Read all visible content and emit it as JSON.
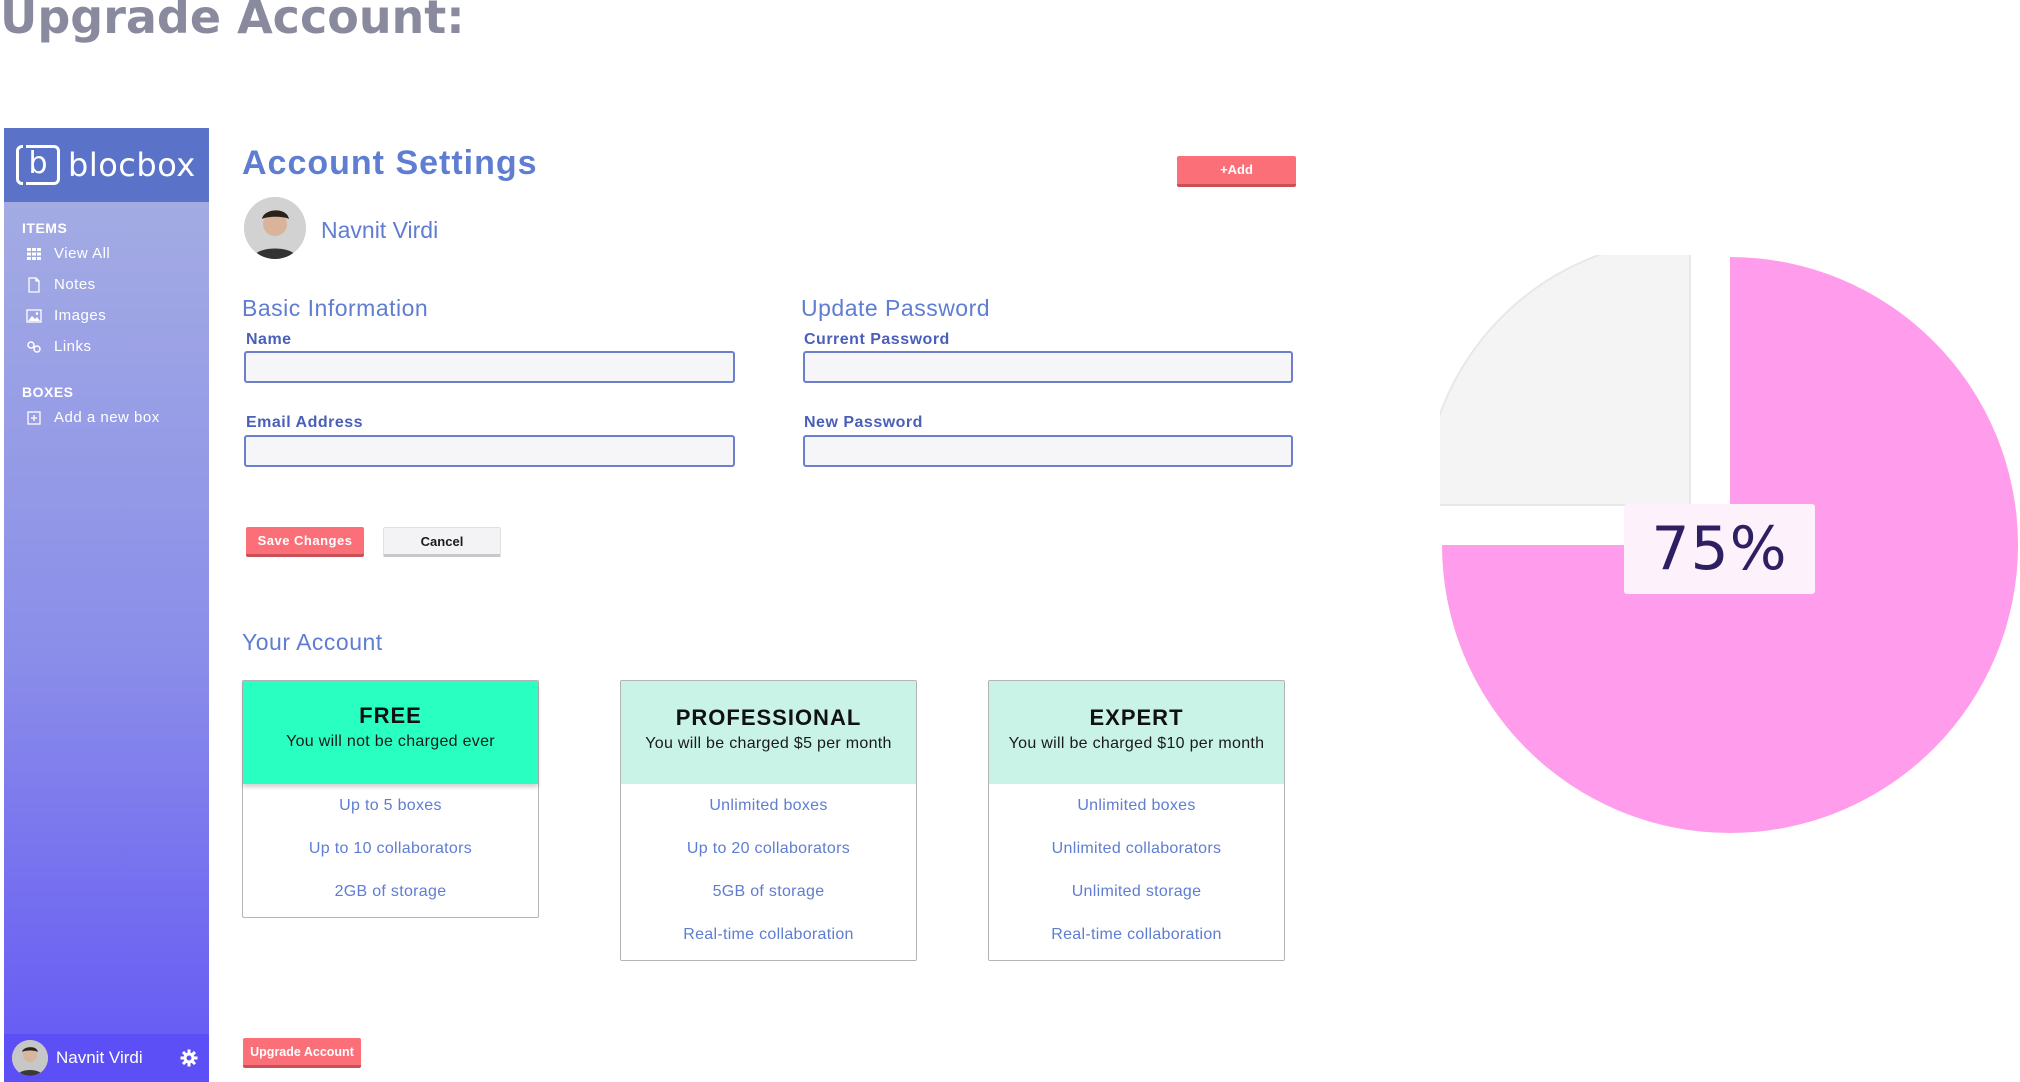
{
  "page": {
    "heading": "Upgrade Account:"
  },
  "sidebar": {
    "brand": {
      "letter": "b",
      "name": "blocbox"
    },
    "sections": [
      {
        "title": "ITEMS",
        "items": [
          {
            "label": "View All",
            "icon": "grid-icon"
          },
          {
            "label": "Notes",
            "icon": "file-icon"
          },
          {
            "label": "Images",
            "icon": "image-icon"
          },
          {
            "label": "Links",
            "icon": "link-icon"
          }
        ]
      },
      {
        "title": "BOXES",
        "items": [
          {
            "label": "Add a new box",
            "icon": "plus-square-icon"
          }
        ]
      }
    ],
    "user": {
      "name": "Navnit Virdi"
    }
  },
  "main": {
    "title": "Account Settings",
    "add_label": "+Add",
    "profile": {
      "name": "Navnit Virdi"
    },
    "basic": {
      "title": "Basic Information",
      "name_label": "Name",
      "name_value": "",
      "email_label": "Email Address",
      "email_value": ""
    },
    "password": {
      "title": "Update Password",
      "current_label": "Current Password",
      "current_value": "",
      "new_label": "New Password",
      "new_value": ""
    },
    "save_label": "Save Changes",
    "cancel_label": "Cancel",
    "account_title": "Your Account",
    "plans": [
      {
        "name": "FREE",
        "desc": "You will not be charged ever",
        "color": "#2affc2",
        "features": [
          "Up to 5 boxes",
          "Up to 10 collaborators",
          "2GB of storage"
        ]
      },
      {
        "name": "PROFESSIONAL",
        "desc": "You will be charged $5 per month",
        "color": "#c9f3e6",
        "features": [
          "Unlimited boxes",
          "Up to 20 collaborators",
          "5GB of storage",
          "Real-time collaboration"
        ]
      },
      {
        "name": "EXPERT",
        "desc": "You will be charged $10 per month",
        "color": "#c9f3e6",
        "features": [
          "Unlimited boxes",
          "Unlimited collaborators",
          "Unlimited storage",
          "Real-time collaboration"
        ]
      }
    ],
    "upgrade_label": "Upgrade Account"
  },
  "usage": {
    "percent": 75,
    "label": "75%",
    "fill_color": "#ff9ceb",
    "rest_color": "#f4f4f4"
  },
  "colors": {
    "accent": "#fa6f78",
    "primary": "#5f7dd1",
    "sidebar_dark": "#5c4ff6"
  }
}
